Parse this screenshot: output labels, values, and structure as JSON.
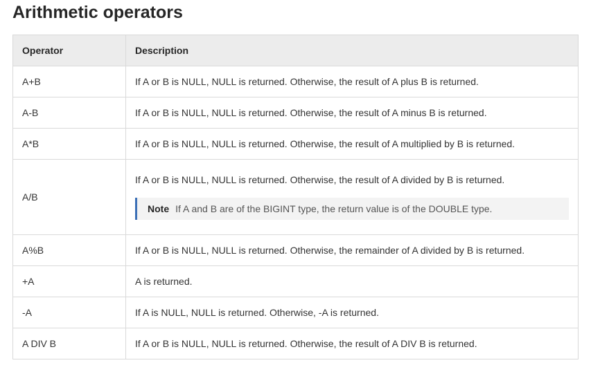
{
  "page": {
    "title": "Arithmetic operators"
  },
  "table": {
    "headers": {
      "operator": "Operator",
      "description": "Description"
    },
    "rows": [
      {
        "operator": "A+B",
        "description": "If A or B is NULL, NULL is returned. Otherwise, the result of A plus B is returned."
      },
      {
        "operator": "A-B",
        "description": "If A or B is NULL, NULL is returned. Otherwise, the result of A minus B is returned."
      },
      {
        "operator": "A*B",
        "description": "If A or B is NULL, NULL is returned. Otherwise, the result of A multiplied by B is returned."
      },
      {
        "operator": "A/B",
        "description": "If A or B is NULL, NULL is returned. Otherwise, the result of A divided by B is returned.",
        "note_label": "Note",
        "note_text": "If A and B are of the BIGINT type, the return value is of the DOUBLE type."
      },
      {
        "operator": "A%B",
        "description": "If A or B is NULL, NULL is returned. Otherwise, the remainder of A divided by B is returned."
      },
      {
        "operator": "+A",
        "description": "A is returned."
      },
      {
        "operator": "-A",
        "description": "If A is NULL, NULL is returned. Otherwise, -A is returned."
      },
      {
        "operator": "A DIV B",
        "description": "If A or B is NULL, NULL is returned. Otherwise, the result of A DIV B is returned."
      }
    ]
  },
  "colors": {
    "header_bg": "#ececec",
    "border": "#d9d9d9",
    "note_bg": "#f3f3f3",
    "note_accent": "#3b6fb6"
  }
}
